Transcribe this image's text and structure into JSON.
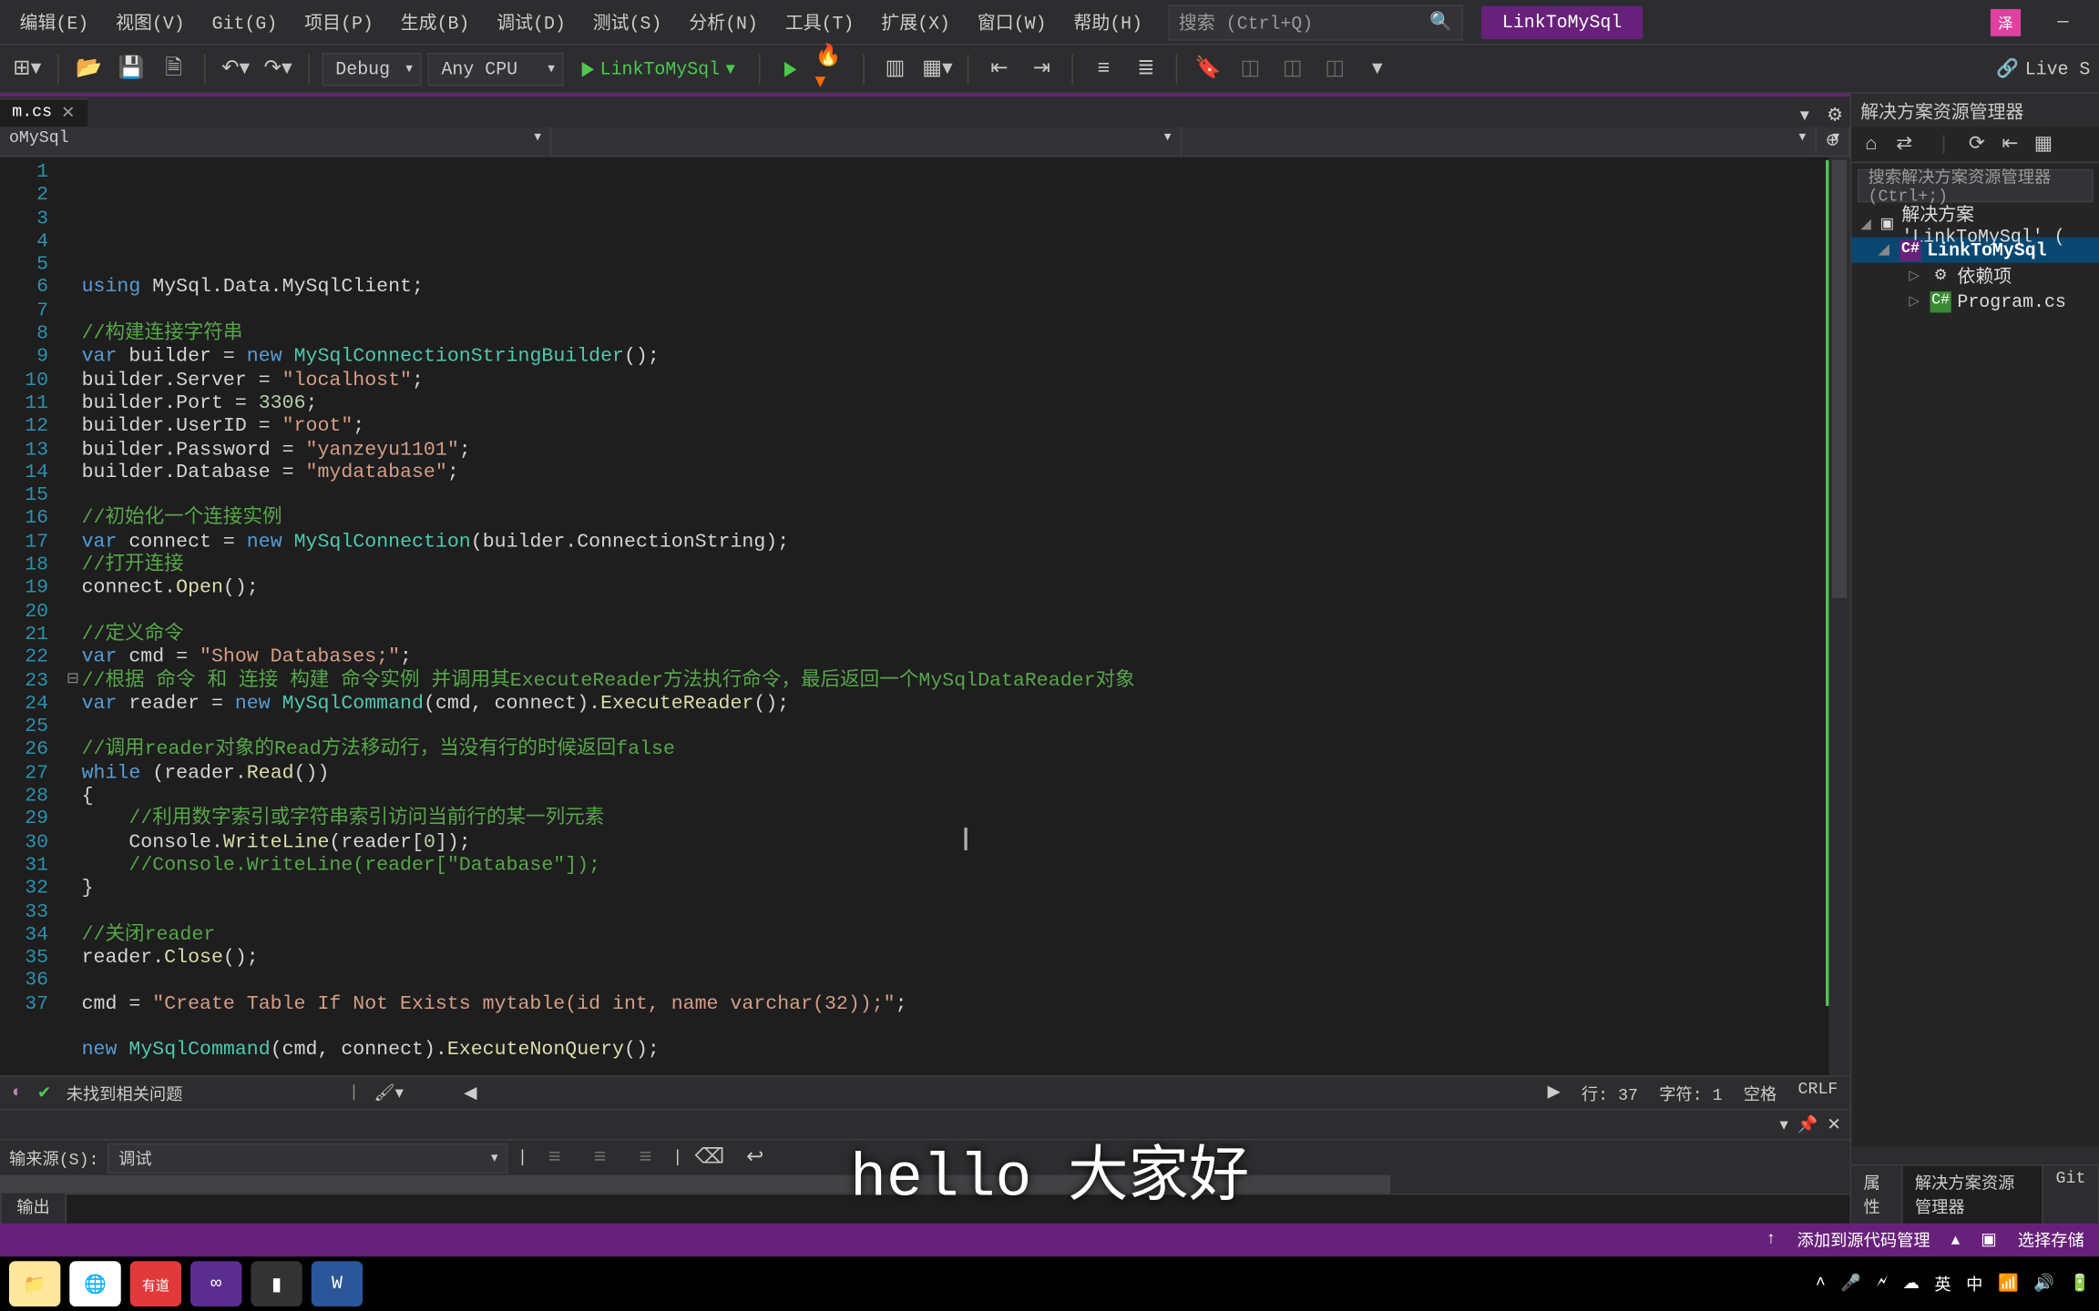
{
  "menu": [
    "编辑(E)",
    "视图(V)",
    "Git(G)",
    "项目(P)",
    "生成(B)",
    "调试(D)",
    "测试(S)",
    "分析(N)",
    "工具(T)",
    "扩展(X)",
    "窗口(W)",
    "帮助(H)"
  ],
  "search_placeholder": "搜索 (Ctrl+Q)",
  "app_pill": "LinkToMySql",
  "badge": "泽",
  "toolbar": {
    "config": "Debug",
    "platform": "Any CPU",
    "start": "LinkToMySql",
    "live_share": "Live S"
  },
  "file_tab": "m.cs",
  "nav_dd": "oMySql",
  "code_lines": [
    {
      "n": 1,
      "h": ""
    },
    {
      "n": 2,
      "h": "<span class='kw'>using</span> MySql.Data.MySqlClient;"
    },
    {
      "n": 3,
      "h": ""
    },
    {
      "n": 4,
      "h": "<span class='cm'>//构建连接字符串</span>"
    },
    {
      "n": 5,
      "h": "<span class='kw'>var</span> builder = <span class='kw'>new</span> <span class='typ'>MySqlConnectionStringBuilder</span>();"
    },
    {
      "n": 6,
      "h": "builder.Server = <span class='str'>\"localhost\"</span>;"
    },
    {
      "n": 7,
      "h": "builder.Port = <span class='num'>3306</span>;"
    },
    {
      "n": 8,
      "h": "builder.UserID = <span class='str'>\"root\"</span>;"
    },
    {
      "n": 9,
      "h": "builder.Password = <span class='str'>\"yanzeyu1101\"</span>;"
    },
    {
      "n": 10,
      "h": "builder.Database = <span class='str'>\"mydatabase\"</span>;"
    },
    {
      "n": 11,
      "h": ""
    },
    {
      "n": 12,
      "h": "<span class='cm'>//初始化一个连接实例</span>"
    },
    {
      "n": 13,
      "h": "<span class='kw'>var</span> connect = <span class='kw'>new</span> <span class='typ'>MySqlConnection</span>(builder.ConnectionString);"
    },
    {
      "n": 14,
      "h": "<span class='cm'>//打开连接</span>"
    },
    {
      "n": 15,
      "h": "connect.<span class='fn'>Open</span>();"
    },
    {
      "n": 16,
      "h": ""
    },
    {
      "n": 17,
      "h": "<span class='cm'>//定义命令</span>"
    },
    {
      "n": 18,
      "h": "<span class='kw'>var</span> cmd = <span class='str'>\"Show Databases;\"</span>;"
    },
    {
      "n": 19,
      "h": "<span class='cm'>//根据 命令 和 连接 构建 命令实例 并调用其ExecuteReader方法执行命令，最后返回一个MySqlDataReader对象</span>"
    },
    {
      "n": 20,
      "h": "<span class='kw'>var</span> reader = <span class='kw'>new</span> <span class='typ'>MySqlCommand</span>(cmd, connect).<span class='fn'>ExecuteReader</span>();"
    },
    {
      "n": 21,
      "h": ""
    },
    {
      "n": 22,
      "h": "<span class='cm'>//调用reader对象的Read方法移动行，当没有行的时候返回false</span>"
    },
    {
      "n": 23,
      "h": "<span class='kw'>while</span> (reader.<span class='fn'>Read</span>())"
    },
    {
      "n": 24,
      "h": "{"
    },
    {
      "n": 25,
      "h": "    <span class='cm'>//利用数字索引或字符串索引访问当前行的某一列元素</span>"
    },
    {
      "n": 26,
      "h": "    Console.<span class='fn'>WriteLine</span>(reader[<span class='num'>0</span>]);"
    },
    {
      "n": 27,
      "h": "    <span class='cm'>//Console.WriteLine(reader[\"Database\"]);</span>"
    },
    {
      "n": 28,
      "h": "}"
    },
    {
      "n": 29,
      "h": ""
    },
    {
      "n": 30,
      "h": "<span class='cm'>//关闭reader</span>"
    },
    {
      "n": 31,
      "h": "reader.<span class='fn'>Close</span>();"
    },
    {
      "n": 32,
      "h": ""
    },
    {
      "n": 33,
      "h": "cmd = <span class='str'>\"Create Table If Not Exists mytable(id int, name varchar(32));\"</span>;"
    },
    {
      "n": 34,
      "h": ""
    },
    {
      "n": 35,
      "h": "<span class='kw'>new</span> <span class='typ'>MySqlCommand</span>(cmd, connect).<span class='fn'>ExecuteNonQuery</span>();"
    },
    {
      "n": 36,
      "h": ""
    },
    {
      "n": 37,
      "h": ""
    }
  ],
  "issue_bar": {
    "ok": "未找到相关问题",
    "ln": "行: 37",
    "ch": "字符: 1",
    "ws": "空格",
    "enc": "CRLF"
  },
  "output": {
    "source_label": "输来源(S):",
    "source_value": "调试",
    "tab": "输出"
  },
  "solution": {
    "title": "解决方案资源管理器",
    "search_placeholder": "搜索解决方案资源管理器(Ctrl+;)",
    "root": "解决方案 'LinkToMySql' (",
    "project": "LinkToMySql",
    "deps": "依赖项",
    "file": "Program.cs",
    "tabs": [
      "属性",
      "解决方案资源管理器",
      "Git"
    ]
  },
  "status_bar": {
    "add_src": "添加到源代码管理",
    "sel_repo": "选择存储"
  },
  "subtitle": "hello  大家好"
}
